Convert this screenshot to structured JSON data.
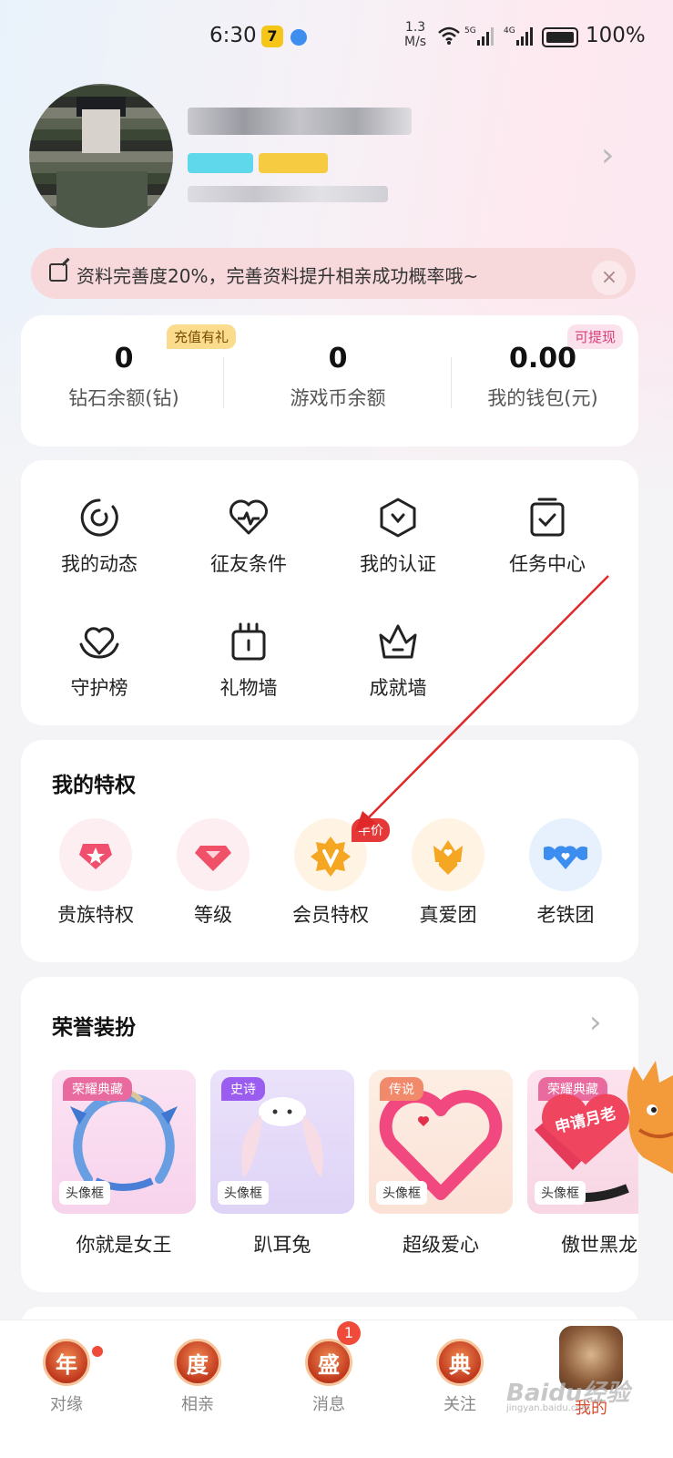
{
  "status_bar": {
    "time": "6:30",
    "net_speed_value": "1.3",
    "net_speed_unit": "M/s",
    "signal1_label": "5G",
    "signal2_label": "4G",
    "battery": "100%",
    "app_icon_text": "7"
  },
  "banner": {
    "text": "资料完善度20%，完善资料提升相亲成功概率哦~",
    "close_label": "×"
  },
  "wallet": {
    "items": [
      {
        "value": "0",
        "label": "钻石余额(钻)"
      },
      {
        "value": "0",
        "label": "游戏币余额"
      },
      {
        "value": "0.00",
        "label": "我的钱包(元)"
      }
    ],
    "recharge_tag": "充值有礼",
    "withdraw_tag": "可提现"
  },
  "menu": {
    "items": [
      {
        "label": "我的动态",
        "icon": "refresh-circle-icon"
      },
      {
        "label": "征友条件",
        "icon": "heart-pulse-icon"
      },
      {
        "label": "我的认证",
        "icon": "shield-check-icon"
      },
      {
        "label": "任务中心",
        "icon": "clipboard-check-icon"
      },
      {
        "label": "守护榜",
        "icon": "heart-hands-icon"
      },
      {
        "label": "礼物墙",
        "icon": "gift-box-icon"
      },
      {
        "label": "成就墙",
        "icon": "crown-icon"
      }
    ]
  },
  "privileges": {
    "title": "我的特权",
    "badge": "半价",
    "items": [
      {
        "label": "贵族特权",
        "icon": "noble-star-icon",
        "color": "#f0506e"
      },
      {
        "label": "等级",
        "icon": "diamond-icon",
        "color": "#f05068"
      },
      {
        "label": "会员特权",
        "icon": "vip-v-icon",
        "color": "#f5a623"
      },
      {
        "label": "真爱团",
        "icon": "heart-crown-icon",
        "color": "#f5a623"
      },
      {
        "label": "老铁团",
        "icon": "heart-wings-icon",
        "color": "#3b8ef0"
      }
    ]
  },
  "honor": {
    "title": "荣誉装扮",
    "items": [
      {
        "name": "你就是女王",
        "tag": "荣耀典藏",
        "type": "头像框"
      },
      {
        "name": "趴耳兔",
        "tag": "史诗",
        "type": "头像框"
      },
      {
        "name": "超级爱心",
        "tag": "传说",
        "type": "头像框"
      },
      {
        "name": "傲世黑龙",
        "tag": "荣耀典藏",
        "type": "头像框"
      }
    ],
    "floating_badge": "申请月老"
  },
  "bottom_nav": {
    "items": [
      {
        "label": "对缘",
        "glyph": "年"
      },
      {
        "label": "相亲",
        "glyph": "度"
      },
      {
        "label": "消息",
        "glyph": "盛"
      },
      {
        "label": "关注",
        "glyph": "典"
      },
      {
        "label": "我的"
      }
    ],
    "message_count": "1",
    "watermark": "Baidu经验",
    "watermark_sub": "jingyan.baidu.com"
  },
  "colors": {
    "accent": "#d84a2c",
    "badge_red": "#e53838",
    "banner_bg": "#f7d9dc"
  }
}
